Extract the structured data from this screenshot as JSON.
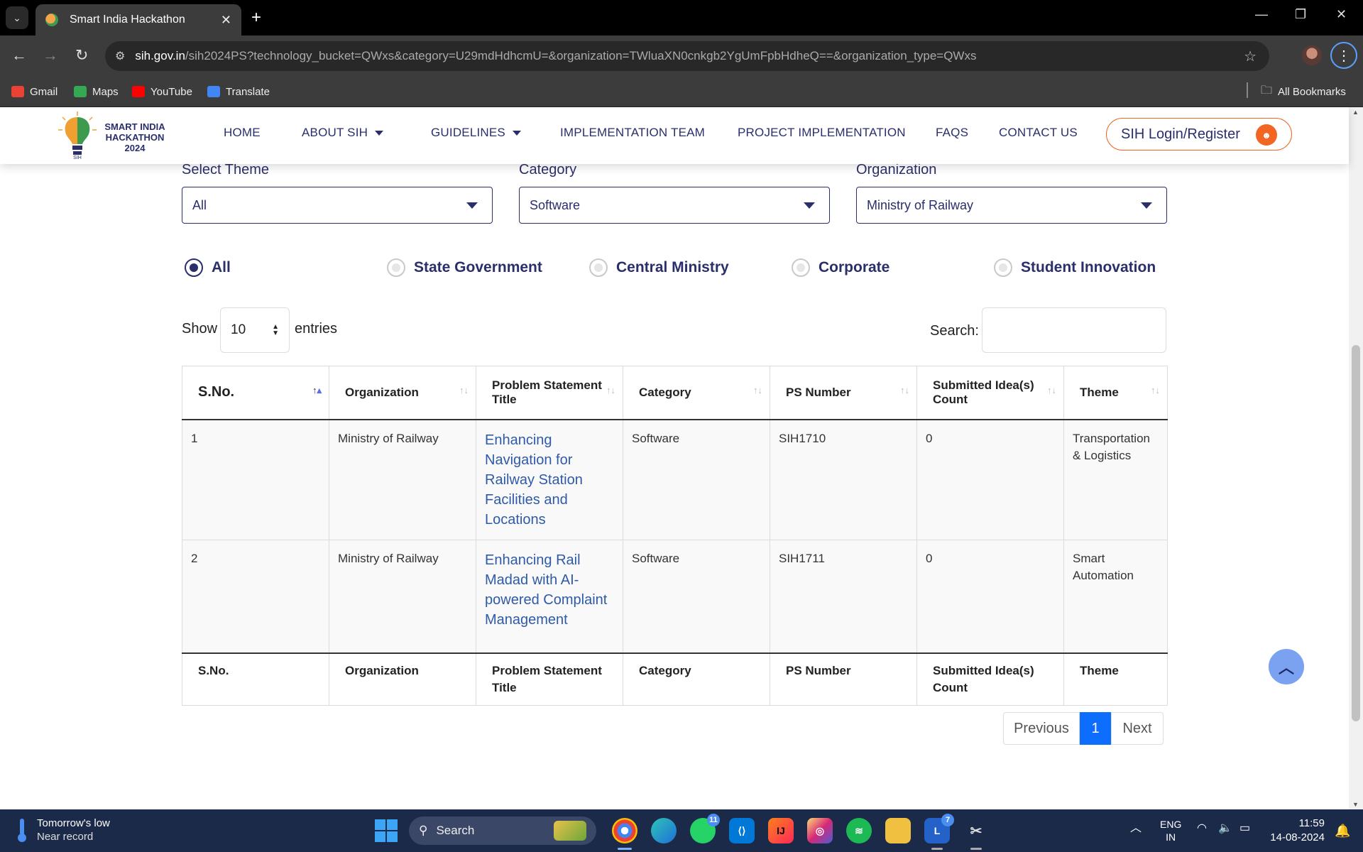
{
  "browser": {
    "tab_title": "Smart India Hackathon",
    "tab_close": "✕",
    "new_tab": "+",
    "url_host": "sih.gov.in",
    "url_path": "/sih2024PS?technology_bucket=QWxs&category=U29mdHdhcmU=&organization=TWluaXN0cnkgb2YgUmFpbHdheQ==&organization_type=QWxs",
    "bookmarks": [
      {
        "label": "Gmail",
        "color": "#ea4335"
      },
      {
        "label": "Maps",
        "color": "#34a853"
      },
      {
        "label": "YouTube",
        "color": "#ff0000"
      },
      {
        "label": "Translate",
        "color": "#4285f4"
      }
    ],
    "all_bookmarks": "All Bookmarks"
  },
  "site": {
    "logo_text": "SMART INDIA HACKATHON 2024",
    "nav": {
      "home": "HOME",
      "about": "ABOUT SIH",
      "guidelines": "GUIDELINES",
      "implementation_team": "IMPLEMENTATION TEAM",
      "project_implementation": "PROJECT IMPLEMENTATION",
      "faqs": "FAQS",
      "contact": "CONTACT US"
    },
    "login": "SIH Login/Register",
    "brand_color": "#2a2f6b",
    "accent_color": "#f26522"
  },
  "filters": {
    "theme_label": "Select Theme",
    "theme_value": "All",
    "category_label": "Category",
    "category_value": "Software",
    "organization_label": "Organization",
    "organization_value": "Ministry of Railway",
    "org_types": [
      "All",
      "State Government",
      "Central Ministry",
      "Corporate",
      "Student Innovation"
    ],
    "org_type_selected": "All"
  },
  "table_controls": {
    "show": "Show",
    "entries_value": "10",
    "entries": "entries",
    "search_label": "Search:"
  },
  "table": {
    "columns": [
      "S.No.",
      "Organization",
      "Problem Statement Title",
      "Category",
      "PS Number",
      "Submitted Idea(s) Count",
      "Theme"
    ],
    "rows": [
      {
        "sno": "1",
        "organization": "Ministry of Railway",
        "title": "Enhancing Navigation for Railway Station Facilities and Locations",
        "category": "Software",
        "ps_number": "SIH1710",
        "count": "0",
        "theme": "Transportation & Logistics"
      },
      {
        "sno": "2",
        "organization": "Ministry of Railway",
        "title": "Enhancing Rail Madad with AI-powered Complaint Management",
        "category": "Software",
        "ps_number": "SIH1711",
        "count": "0",
        "theme": "Smart Automation"
      }
    ]
  },
  "pagination": {
    "previous": "Previous",
    "current": "1",
    "next": "Next"
  },
  "taskbar": {
    "weather_line1": "Tomorrow's low",
    "weather_line2": "Near record",
    "search": "Search",
    "whatsapp_badge": "11",
    "l_badge": "7",
    "lang_line1": "ENG",
    "lang_line2": "IN",
    "time": "11:59",
    "date": "14-08-2024"
  }
}
